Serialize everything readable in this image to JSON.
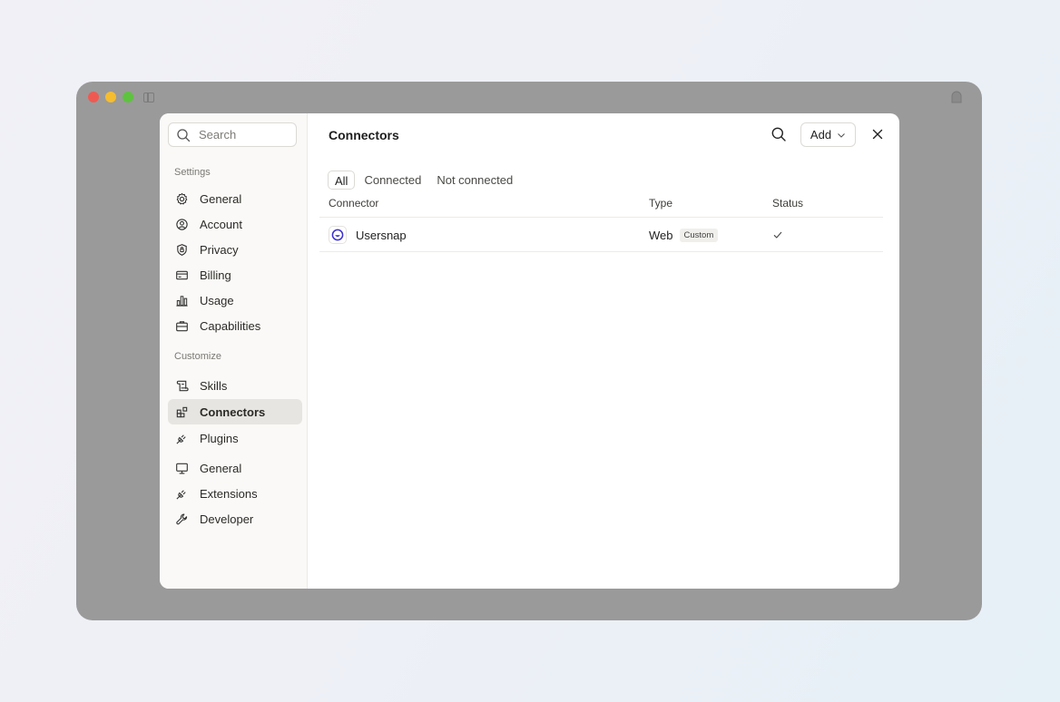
{
  "sidebar": {
    "search_placeholder": "Search",
    "settings_label": "Settings",
    "settings_items": [
      {
        "label": "General",
        "icon": "gear-icon"
      },
      {
        "label": "Account",
        "icon": "user-circle-icon"
      },
      {
        "label": "Privacy",
        "icon": "shield-icon"
      },
      {
        "label": "Billing",
        "icon": "credit-card-icon"
      },
      {
        "label": "Usage",
        "icon": "bar-chart-icon"
      },
      {
        "label": "Capabilities",
        "icon": "briefcase-icon"
      }
    ],
    "customize_label": "Customize",
    "customize_items": [
      {
        "label": "Skills",
        "icon": "scroll-icon"
      },
      {
        "label": "Connectors",
        "icon": "blocks-icon",
        "active": true
      },
      {
        "label": "Plugins",
        "icon": "plug-icon"
      }
    ],
    "app_items": [
      {
        "label": "General",
        "icon": "monitor-icon"
      },
      {
        "label": "Extensions",
        "icon": "plug-icon"
      },
      {
        "label": "Developer",
        "icon": "wrench-icon"
      }
    ]
  },
  "header": {
    "title": "Connectors",
    "add_label": "Add"
  },
  "tabs": [
    "All",
    "Connected",
    "Not connected"
  ],
  "active_tab": "All",
  "table": {
    "columns": [
      "Connector",
      "Type",
      "Status"
    ],
    "rows": [
      {
        "name": "Usersnap",
        "type": "Web",
        "badge": "Custom",
        "status": "connected",
        "icon": "usersnap-logo-icon"
      }
    ]
  },
  "colors": {
    "accent_usersnap": "#3b2fd0",
    "window_bg": "#9a9a9a",
    "sidebar_bg": "#faf9f7",
    "active_item_bg": "#e6e5e1"
  }
}
